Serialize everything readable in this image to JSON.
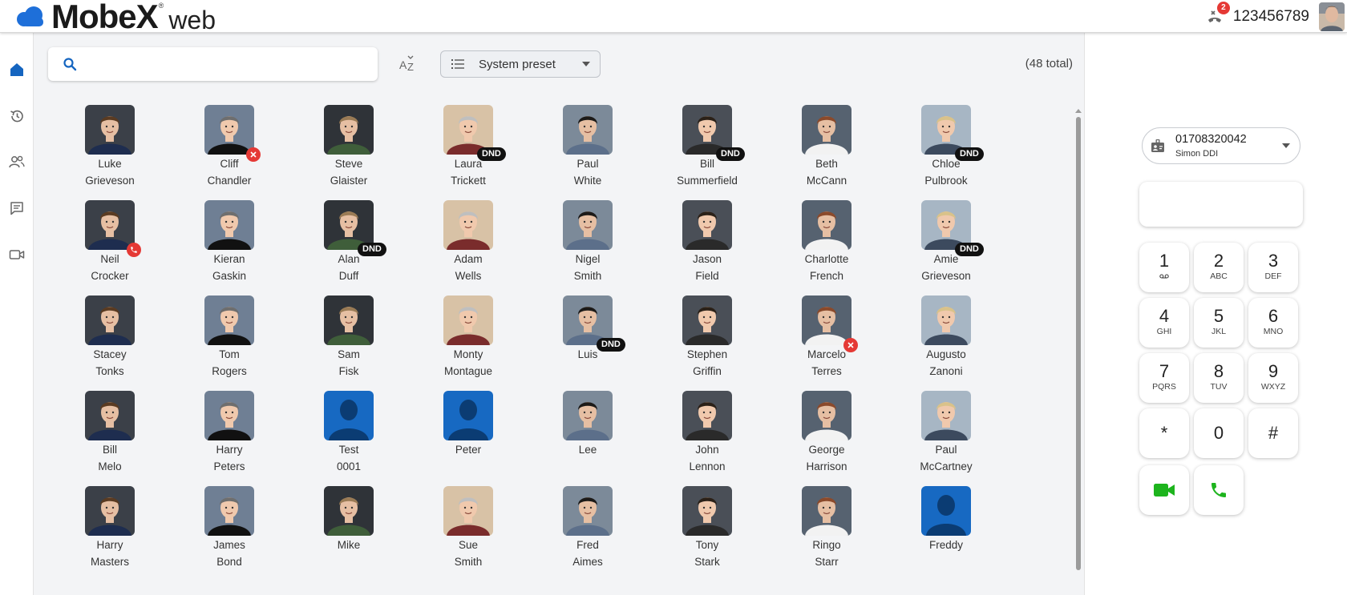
{
  "app": {
    "logo_word": "MobeX",
    "logo_reg": "®",
    "logo_suffix": "web",
    "presence_badge_count": "2",
    "account_number": "123456789"
  },
  "nav": [
    {
      "id": "home",
      "icon": "home-icon",
      "active": true
    },
    {
      "id": "history",
      "icon": "history-icon"
    },
    {
      "id": "contacts",
      "icon": "contacts-icon"
    },
    {
      "id": "chat",
      "icon": "chat-icon"
    },
    {
      "id": "video",
      "icon": "video-icon"
    }
  ],
  "toolbar": {
    "search_placeholder": "",
    "sort_icon": "sort-az-icon",
    "preset_label": "System preset",
    "total_label": "(48 total)"
  },
  "contacts": [
    {
      "first": "Luke",
      "last": "Grieveson",
      "status": "",
      "photo": "photo"
    },
    {
      "first": "Cliff",
      "last": "Chandler",
      "status": "offline",
      "photo": "photo"
    },
    {
      "first": "Steve",
      "last": "Glaister",
      "status": "",
      "photo": "photo"
    },
    {
      "first": "Laura",
      "last": "Trickett",
      "status": "DND",
      "photo": "photo"
    },
    {
      "first": "Paul",
      "last": "White",
      "status": "",
      "photo": "photo"
    },
    {
      "first": "Bill",
      "last": "Summerfield",
      "status": "DND",
      "photo": "photo"
    },
    {
      "first": "Beth",
      "last": "McCann",
      "status": "",
      "photo": "photo"
    },
    {
      "first": "Chloe",
      "last": "Pulbrook",
      "status": "DND",
      "photo": "photo"
    },
    {
      "first": "Neil",
      "last": "Crocker",
      "status": "on-call",
      "photo": "photo"
    },
    {
      "first": "Kieran",
      "last": "Gaskin",
      "status": "",
      "photo": "photo"
    },
    {
      "first": "Alan",
      "last": "Duff",
      "status": "DND",
      "photo": "photo"
    },
    {
      "first": "Adam",
      "last": "Wells",
      "status": "",
      "photo": "photo"
    },
    {
      "first": "Nigel",
      "last": "Smith",
      "status": "",
      "photo": "photo"
    },
    {
      "first": "Jason",
      "last": "Field",
      "status": "",
      "photo": "photo"
    },
    {
      "first": "Charlotte",
      "last": "French",
      "status": "",
      "photo": "photo"
    },
    {
      "first": "Amie",
      "last": "Grieveson",
      "status": "DND",
      "photo": "photo"
    },
    {
      "first": "Stacey",
      "last": "Tonks",
      "status": "",
      "photo": "photo"
    },
    {
      "first": "Tom",
      "last": "Rogers",
      "status": "",
      "photo": "photo"
    },
    {
      "first": "Sam",
      "last": "Fisk",
      "status": "",
      "photo": "photo"
    },
    {
      "first": "Monty",
      "last": "Montague",
      "status": "",
      "photo": "photo"
    },
    {
      "first": "Luis",
      "last": "",
      "status": "DND",
      "photo": "photo"
    },
    {
      "first": "Stephen",
      "last": "Griffin",
      "status": "",
      "photo": "photo"
    },
    {
      "first": "Marcelo",
      "last": "Terres",
      "status": "offline",
      "photo": "photo"
    },
    {
      "first": "Augusto",
      "last": "Zanoni",
      "status": "",
      "photo": "photo"
    },
    {
      "first": "Bill",
      "last": "Melo",
      "status": "",
      "photo": "photo"
    },
    {
      "first": "Harry",
      "last": "Peters",
      "status": "",
      "photo": "photo"
    },
    {
      "first": "Test",
      "last": "0001",
      "status": "",
      "photo": "placeholder"
    },
    {
      "first": "Peter",
      "last": "",
      "status": "",
      "photo": "placeholder"
    },
    {
      "first": "Lee",
      "last": "",
      "status": "",
      "photo": "photo"
    },
    {
      "first": "John",
      "last": "Lennon",
      "status": "",
      "photo": "photo"
    },
    {
      "first": "George",
      "last": "Harrison",
      "status": "",
      "photo": "photo"
    },
    {
      "first": "Paul",
      "last": "McCartney",
      "status": "",
      "photo": "photo"
    },
    {
      "first": "Harry",
      "last": "Masters",
      "status": "",
      "photo": "photo"
    },
    {
      "first": "James",
      "last": "Bond",
      "status": "",
      "photo": "photo"
    },
    {
      "first": "Mike",
      "last": "",
      "status": "",
      "photo": "photo"
    },
    {
      "first": "Sue",
      "last": "Smith",
      "status": "",
      "photo": "photo"
    },
    {
      "first": "Fred",
      "last": "Aimes",
      "status": "",
      "photo": "photo"
    },
    {
      "first": "Tony",
      "last": "Stark",
      "status": "",
      "photo": "photo"
    },
    {
      "first": "Ringo",
      "last": "Starr",
      "status": "",
      "photo": "photo"
    },
    {
      "first": "Freddy",
      "last": "",
      "status": "",
      "photo": "placeholder"
    }
  ],
  "dialer": {
    "cli_number": "01708320042",
    "cli_name": "Simon DDI",
    "display_value": "",
    "keys": [
      {
        "digit": "1",
        "letters": "",
        "icon": "voicemail-icon"
      },
      {
        "digit": "2",
        "letters": "ABC"
      },
      {
        "digit": "3",
        "letters": "DEF"
      },
      {
        "digit": "4",
        "letters": "GHI"
      },
      {
        "digit": "5",
        "letters": "JKL"
      },
      {
        "digit": "6",
        "letters": "MNO"
      },
      {
        "digit": "7",
        "letters": "PQRS"
      },
      {
        "digit": "8",
        "letters": "TUV"
      },
      {
        "digit": "9",
        "letters": "WXYZ"
      },
      {
        "digit": "*",
        "letters": ""
      },
      {
        "digit": "0",
        "letters": ""
      },
      {
        "digit": "#",
        "letters": ""
      }
    ],
    "call_buttons": [
      {
        "icon": "video-call-icon",
        "color": "#1db41d"
      },
      {
        "icon": "phone-call-icon",
        "color": "#1db41d"
      }
    ]
  },
  "colors": {
    "accent_blue": "#1565c0",
    "brand_cloud": "#1e6fd9",
    "dnd_badge": "#111111",
    "alert_red": "#e53935",
    "call_green": "#1db41d",
    "placeholder_blue": "#1769c2"
  }
}
